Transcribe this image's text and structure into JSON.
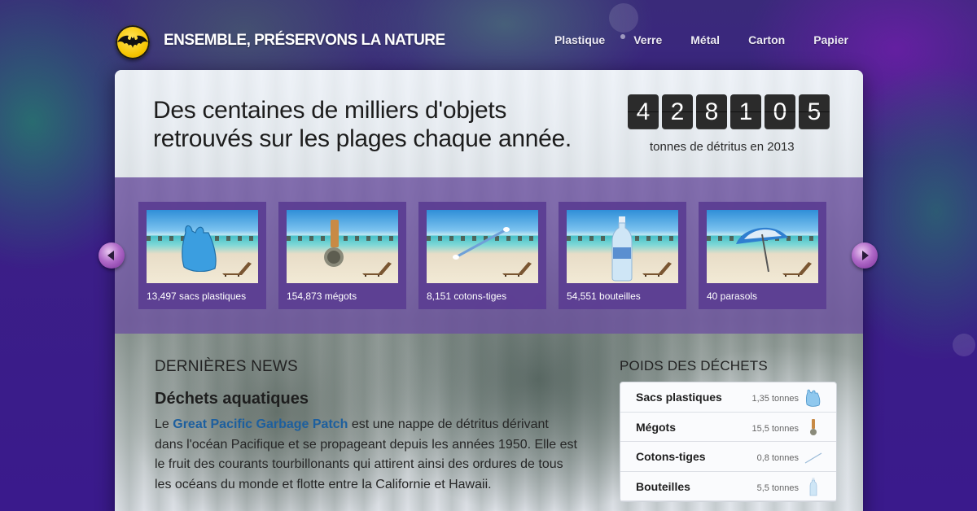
{
  "site": {
    "title": "ENSEMBLE, PRÉSERVONS LA NATURE",
    "logo": "batman-logo"
  },
  "nav": {
    "items": [
      {
        "label": "Plastique"
      },
      {
        "label": "Verre"
      },
      {
        "label": "Métal"
      },
      {
        "label": "Carton"
      },
      {
        "label": "Papier"
      }
    ]
  },
  "hero": {
    "headline_line1": "Des centaines de milliers d'objets",
    "headline_line2": "retrouvés sur les plages chaque année.",
    "counter_digits": [
      "4",
      "2",
      "8",
      "1",
      "0",
      "5"
    ],
    "counter_label": "tonnes de détritus en 2013"
  },
  "carousel": {
    "items": [
      {
        "caption": "13,497 sacs plastiques",
        "icon": "plastic-bag-icon"
      },
      {
        "caption": "154,873 mégots",
        "icon": "cigarette-butt-icon"
      },
      {
        "caption": "8,151 cotons-tiges",
        "icon": "cotton-swab-icon"
      },
      {
        "caption": "54,551 bouteilles",
        "icon": "bottle-icon"
      },
      {
        "caption": "40 parasols",
        "icon": "parasol-icon"
      }
    ]
  },
  "news": {
    "section_title": "DERNIÈRES NEWS",
    "article_title": "Déchets aquatiques",
    "body_prefix": "Le ",
    "link_text": "Great Pacific Garbage Patch",
    "body_rest": " est une nappe de détritus dérivant dans l'océan Pacifique et se propageant depuis les années 1950. Elle est le fruit des courants tourbillonants qui attirent ainsi des ordures de tous les océans du monde et flotte entre la Californie et Hawaii."
  },
  "weights": {
    "section_title": "POIDS DES DÉCHETS",
    "rows": [
      {
        "name": "Sacs plastiques",
        "value": "1,35 tonnes",
        "icon": "plastic-bag-icon"
      },
      {
        "name": "Mégots",
        "value": "15,5 tonnes",
        "icon": "cigarette-butt-icon"
      },
      {
        "name": "Cotons-tiges",
        "value": "0,8 tonnes",
        "icon": "cotton-swab-icon"
      },
      {
        "name": "Bouteilles",
        "value": "5,5 tonnes",
        "icon": "bottle-icon"
      }
    ]
  },
  "colors": {
    "background": "#3b1f86",
    "band": "#6b50a0",
    "link": "#1d5f9e",
    "counter": "#2b2b2b"
  }
}
